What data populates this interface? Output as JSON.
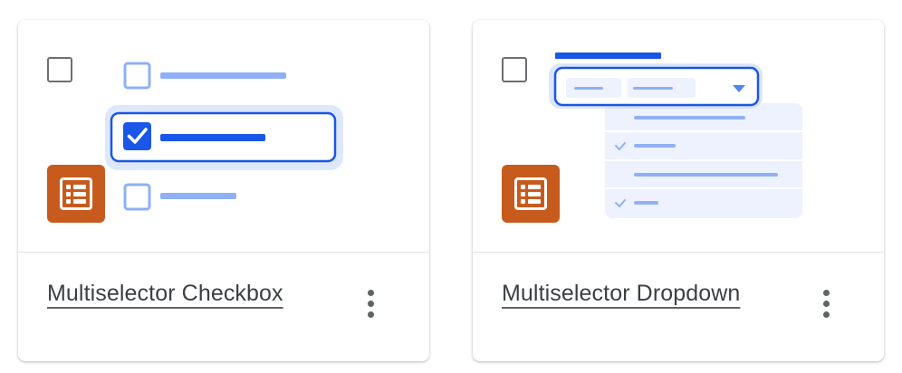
{
  "cards": [
    {
      "title": "Multiselector Checkbox",
      "more_icon": "more-vert-icon",
      "illustration": "checkbox-list"
    },
    {
      "title": "Multiselector Dropdown",
      "more_icon": "more-vert-icon",
      "illustration": "dropdown-list"
    }
  ],
  "colors": {
    "accent_blue": "#1a56e8",
    "light_blue": "#8fb0f5",
    "pale_blue": "#eef2fe",
    "form_icon_orange": "#c75b1e",
    "title_text": "#3c4043",
    "divider": "#e2e3e6"
  }
}
